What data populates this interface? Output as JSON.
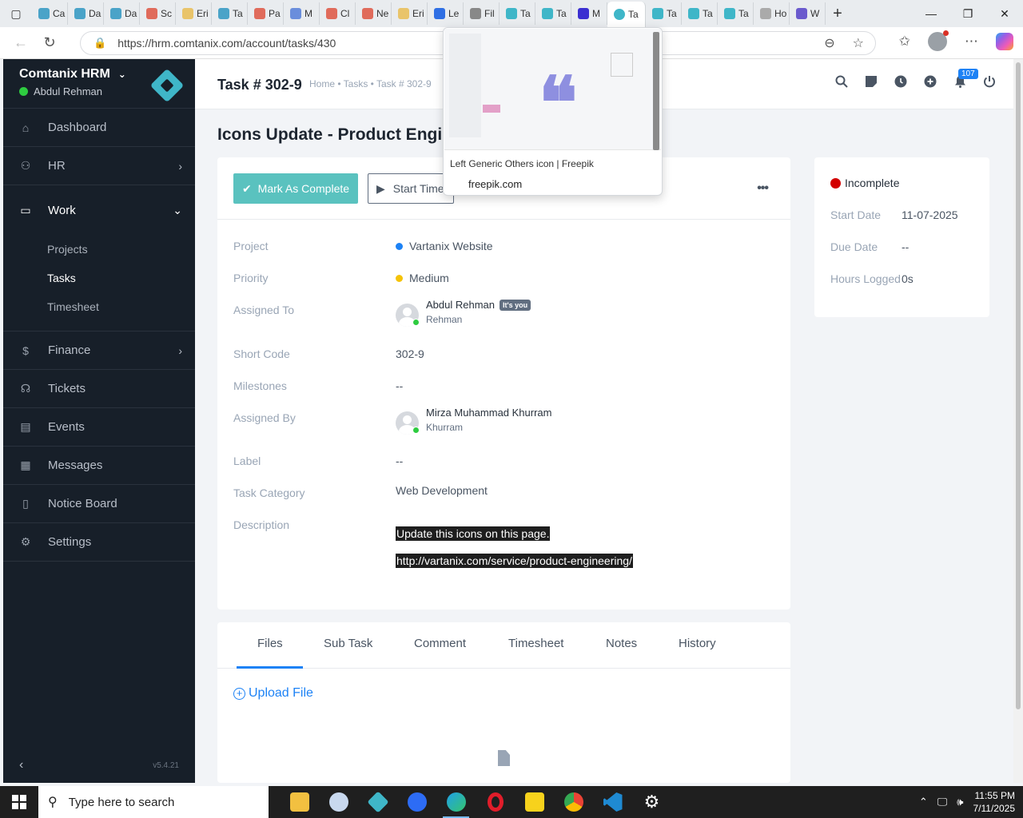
{
  "browser": {
    "tabs": [
      {
        "label": "Ca",
        "color": "#4aa3c8"
      },
      {
        "label": "Da",
        "color": "#4aa3c8"
      },
      {
        "label": "Da",
        "color": "#4aa3c8"
      },
      {
        "label": "Sc",
        "color": "#e06b5b"
      },
      {
        "label": "Eri",
        "color": "#e9c46a"
      },
      {
        "label": "Ta",
        "color": "#4aa3c8"
      },
      {
        "label": "Pa",
        "color": "#e06b5b"
      },
      {
        "label": "M",
        "color": "#6a8edc"
      },
      {
        "label": "Cl",
        "color": "#e06b5b"
      },
      {
        "label": "Ne",
        "color": "#e06b5b"
      },
      {
        "label": "Eri",
        "color": "#e9c46a"
      },
      {
        "label": "Le",
        "color": "#2f6fe4"
      },
      {
        "label": "Fil",
        "color": "#888888"
      },
      {
        "label": "Ta",
        "color": "#3fb6c8"
      },
      {
        "label": "Ta",
        "color": "#3fb6c8"
      },
      {
        "label": "M",
        "color": "#3b2fd1"
      }
    ],
    "active_tab": {
      "label": "Ta"
    },
    "tabs_after": [
      {
        "label": "Ta",
        "color": "#3fb6c8"
      },
      {
        "label": "Ta",
        "color": "#3fb6c8"
      },
      {
        "label": "Ta",
        "color": "#3fb6c8"
      },
      {
        "label": "Ho",
        "color": "#aaaaaa"
      },
      {
        "label": "W",
        "color": "#6a5acd"
      }
    ],
    "url": "https://hrm.comtanix.com/account/tasks/430"
  },
  "preview": {
    "title": "Left Generic Others icon | Freepik",
    "domain": "freepik.com",
    "glyph": "❝"
  },
  "sidebar": {
    "company": "Comtanix HRM",
    "user": "Abdul Rehman",
    "items": [
      {
        "label": "Dashboard",
        "icon": "home-icon"
      },
      {
        "label": "HR",
        "icon": "users-icon"
      }
    ],
    "work": {
      "label": "Work",
      "children": [
        "Projects",
        "Tasks",
        "Timesheet"
      ]
    },
    "items_after": [
      {
        "label": "Finance",
        "icon": "dollar-icon"
      },
      {
        "label": "Tickets",
        "icon": "headset-icon"
      },
      {
        "label": "Events",
        "icon": "calendar-icon"
      },
      {
        "label": "Messages",
        "icon": "message-icon"
      },
      {
        "label": "Notice Board",
        "icon": "clipboard-icon"
      },
      {
        "label": "Settings",
        "icon": "gear-icon"
      }
    ],
    "version": "v5.4.21"
  },
  "header": {
    "task_title": "Task # 302-9",
    "breadcrumb": "Home • Tasks • Task # 302-9",
    "notification_count": "107"
  },
  "page_title": "Icons Update - Product Engineering",
  "actions": {
    "complete_label": "Mark As Complete",
    "timer_label": "Start Timer"
  },
  "details": {
    "project_label": "Project",
    "project_value": "Vartanix Website",
    "priority_label": "Priority",
    "priority_value": "Medium",
    "assigned_to_label": "Assigned To",
    "assigned_to_name": "Abdul Rehman",
    "assigned_to_badge": "It's you",
    "assigned_to_user": "Rehman",
    "short_code_label": "Short Code",
    "short_code_value": "302-9",
    "milestones_label": "Milestones",
    "milestones_value": "--",
    "assigned_by_label": "Assigned By",
    "assigned_by_name": "Mirza Muhammad Khurram",
    "assigned_by_user": "Khurram",
    "label_label": "Label",
    "label_value": "--",
    "category_label": "Task Category",
    "category_value": "Web Development",
    "description_label": "Description",
    "description_line1": "Update this icons on this page.",
    "description_line2": "http://vartanix.com/service/product-engineering/"
  },
  "tabs": [
    "Files",
    "Sub Task",
    "Comment",
    "Timesheet",
    "Notes",
    "History"
  ],
  "files": {
    "upload_label": "Upload File"
  },
  "status_card": {
    "status": "Incomplete",
    "start_date_label": "Start Date",
    "start_date_value": "11-07-2025",
    "due_date_label": "Due Date",
    "due_date_value": "--",
    "hours_label": "Hours Logged",
    "hours_value": "0s"
  },
  "taskbar": {
    "search_placeholder": "Type here to search",
    "time": "11:55 PM",
    "date": "7/11/2025"
  }
}
